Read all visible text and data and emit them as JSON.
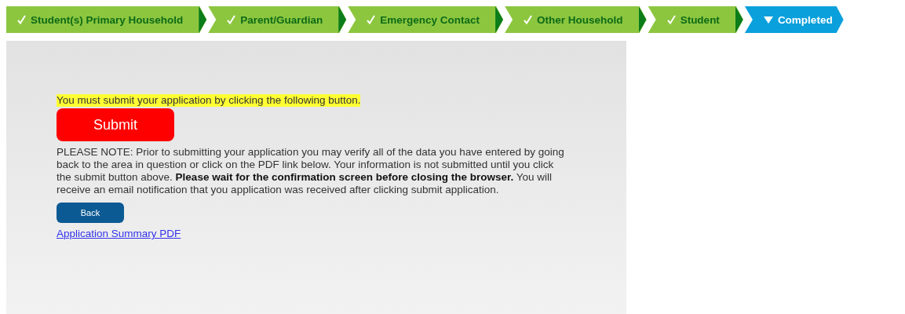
{
  "steps": [
    {
      "label": "Student(s) Primary Household",
      "selected": false
    },
    {
      "label": "Parent/Guardian",
      "selected": false
    },
    {
      "label": "Emergency Contact",
      "selected": false
    },
    {
      "label": "Other Household",
      "selected": false
    },
    {
      "label": "Student",
      "selected": false
    },
    {
      "label": "Completed",
      "selected": true
    }
  ],
  "notice": "You must submit your application by clicking the following button.",
  "submit_button": "Submit",
  "note": "PLEASE NOTE: Prior to submitting your application you may verify all of the data you have entered by going back to the area in question or click on the PDF link below. Your information is not submitted until you click the submit button above. **Please wait for the confirmation screen before closing the browser.** You will receive an email notification that you application was received after clicking submit application.",
  "back_button": "Back",
  "pdf_link": "Application Summary PDF"
}
